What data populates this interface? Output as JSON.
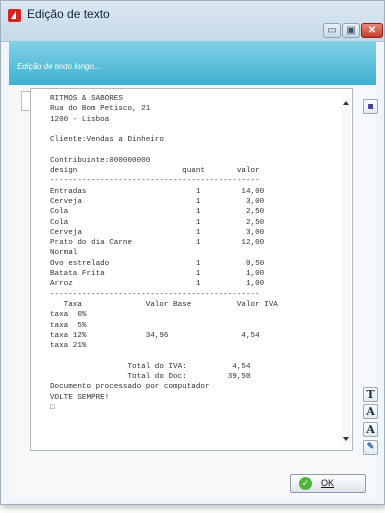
{
  "window": {
    "title": "Edição de texto",
    "controls": {
      "minimize": "▭",
      "maximize": "▣",
      "close": "✕"
    }
  },
  "header": {
    "subtitle": "Edição de texto longo..."
  },
  "document": {
    "lines": [
      "RITMOS & SABORES",
      "Rua do Bom Petisco, 21",
      "1200 - Lisboa",
      "",
      "Cliente:Vendas a Dinheiro",
      "",
      "Contribuinte:000000000",
      "design                       quant       valor",
      "----------------------------------------------",
      "Entradas                        1         14,00",
      "Cerveja                         1          3,00",
      "Cola                            1          2,50",
      "Cola                            1          2,50",
      "Cerveja                         1          3,00",
      "Prato do dia Carne              1         12,00",
      "Normal",
      "Ovo estrelado                   1          0,50",
      "Batata Frita                    1          1,00",
      "Arroz                           1          1,00",
      "----------------------------------------------",
      "   Taxa              Valor Base          Valor IVA",
      "taxa  0%",
      "taxa  5%",
      "taxa 12%             34,96                4,54",
      "taxa 21%",
      "",
      "                 Total do IVA:          4,54",
      "                 Total do Doc:         39,50",
      "Documento processado por computador",
      "VOLTE SEMPRE!",
      "□"
    ]
  },
  "toolbar": {
    "save_icon": "floppy-icon",
    "font_label": "T",
    "grow_label": "A",
    "shrink_label": "A",
    "edit_icon": "edit-icon"
  },
  "buttons": {
    "ok_label": "OK"
  },
  "colors": {
    "header_band": "#3fb1d1",
    "close_button": "#c33b26",
    "accent_red": "#d22424"
  }
}
